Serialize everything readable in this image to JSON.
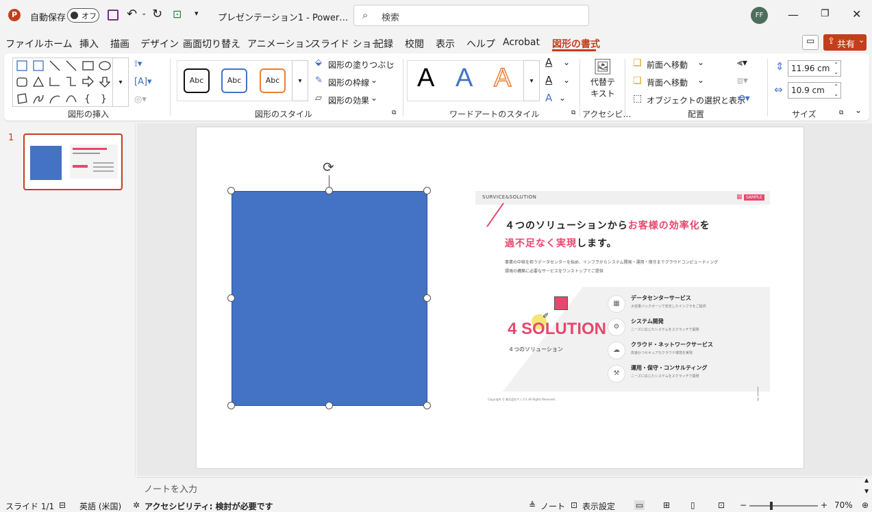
{
  "titlebar": {
    "autosave_label": "自動保存",
    "autosave_state": "オフ",
    "doc_title": "プレゼンテーション1  -  Power…",
    "search_placeholder": "検索",
    "user_initials": "FF"
  },
  "menu": [
    "ファイル",
    "ホーム",
    "挿入",
    "描画",
    "デザイン",
    "画面切り替え",
    "アニメーション",
    "スライド ショー",
    "記録",
    "校閲",
    "表示",
    "ヘルプ",
    "Acrobat",
    "図形の書式"
  ],
  "share_label": "共有",
  "ribbon": {
    "group_insert_shapes": "図形の挿入",
    "group_shape_styles": "図形のスタイル",
    "style_samples": [
      "Abc",
      "Abc",
      "Abc"
    ],
    "fill": "図形の塗りつぶし",
    "outline": "図形の枠線",
    "effects": "図形の効果",
    "group_wordart": "ワードアートのスタイル",
    "wordart_samples": [
      "A",
      "A",
      "A"
    ],
    "alt_text_line1": "代替テ",
    "alt_text_line2": "キスト",
    "group_accessibility": "アクセシビ…",
    "bring_forward": "前面へ移動",
    "send_backward": "背面へ移動",
    "selection_pane": "オブジェクトの選択と表示",
    "group_arrange": "配置",
    "height": "11.96 cm",
    "width": "10.9 cm",
    "group_size": "サイズ"
  },
  "slide_panel": {
    "slide_number": "1"
  },
  "slide": {
    "header_left": "SURVICE&SOLUTION",
    "header_badge": "SAMPLE",
    "heading_part1": "４つのソリューションから",
    "heading_part2": "お客様の効率化",
    "heading_part3": "を",
    "heading_part4": "過不足なく実現",
    "heading_part5": "します。",
    "body_line1": "事業の中核を担うデータセンターを始め、インフラからシステム開発・運用・保守までクラウドコンピューティング",
    "body_line2": "環境の構築に必要なサービスをワンストップでご提供",
    "big_label": "4 SOLUTION",
    "big_sub": "４つのソリューション",
    "services": [
      {
        "title": "データセンターサービス",
        "desc": "大容量バックボーンで安定したインフラをご提供"
      },
      {
        "title": "システム開発",
        "desc": "ニーズに応じたシステムをスクラッチで開発"
      },
      {
        "title": "クラウド・ネットワークサービス",
        "desc": "高速かつセキュアなクラウド環境を実現"
      },
      {
        "title": "運用・保守・コンサルティング",
        "desc": "ニーズに応じたシステムをスクラッチで開発"
      }
    ],
    "copyright": "Copyright © 株式会社サンプル All Rights Reserved.",
    "page_no": "2"
  },
  "notes_placeholder": "ノートを入力",
  "status": {
    "slide_info": "スライド 1/1",
    "language": "英語 (米国)",
    "accessibility": "アクセシビリティ: 検討が必要です",
    "notes": "ノート",
    "display_settings": "表示設定",
    "zoom": "70%"
  },
  "colors": {
    "accent": "#c43e1c",
    "shape_blue": "#4472c4",
    "pink": "#e8466d",
    "tab_active": "#c43e1c"
  }
}
